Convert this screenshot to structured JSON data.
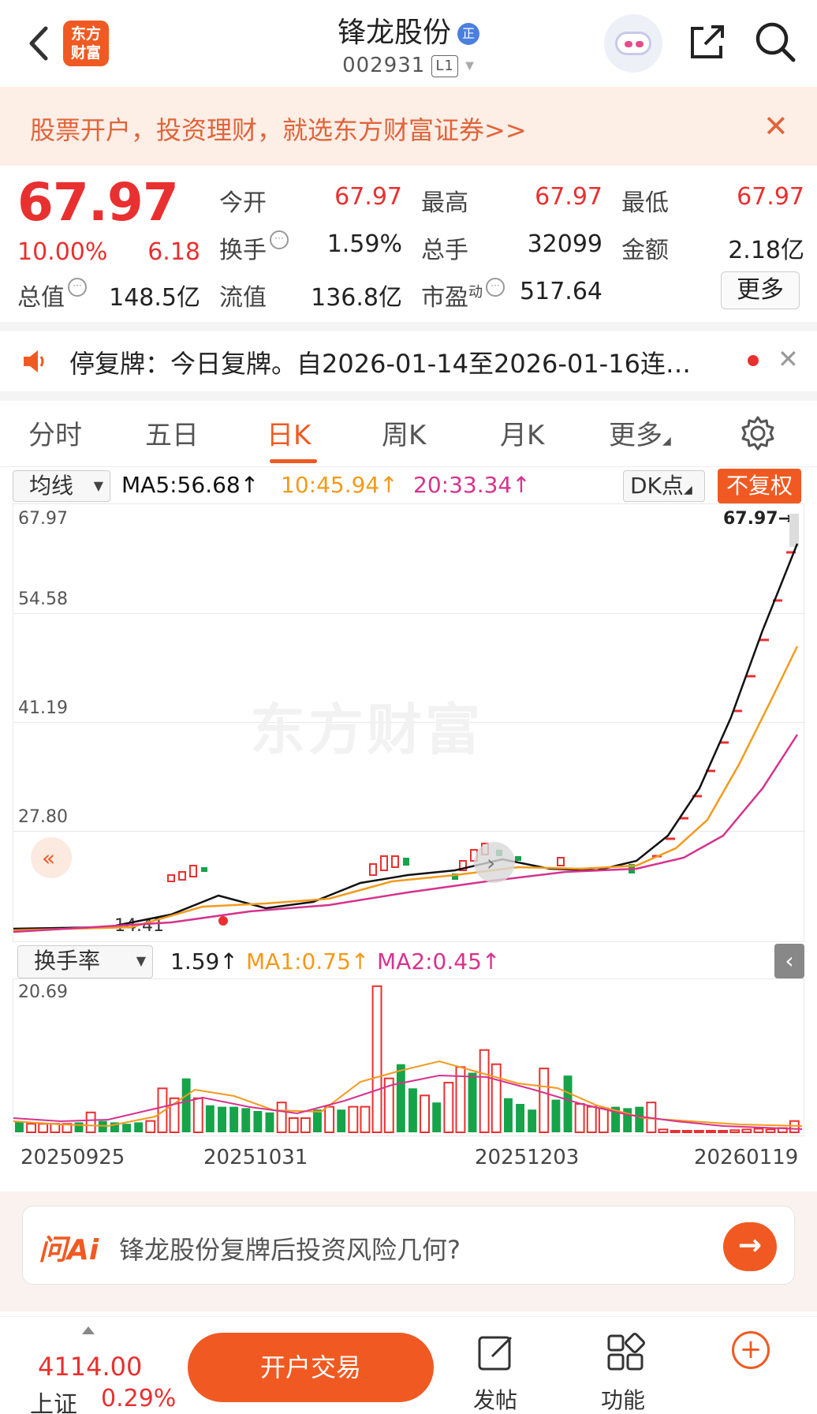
{
  "nav": {
    "logo_line1": "东方",
    "logo_line2": "财富",
    "stock_name": "锋龙股份",
    "badge": "正",
    "stock_code": "002931",
    "level": "L1"
  },
  "banner": {
    "text": "股票开户，投资理财，就选东方财富证券>>",
    "close": "✕"
  },
  "quote": {
    "price": "67.97",
    "change_pct": "10.00%",
    "change": "6.18",
    "open_label": "今开",
    "open": "67.97",
    "high_label": "最高",
    "high": "67.97",
    "low_label": "最低",
    "low": "67.97",
    "turnover_label": "换手",
    "turnover": "1.59%",
    "volume_label": "总手",
    "volume": "32099",
    "amount_label": "金额",
    "amount": "2.18亿",
    "mktcap_label": "总值",
    "mktcap": "148.5亿",
    "float_label": "流值",
    "float_cap": "136.8亿",
    "pe_label": "市盈",
    "pe_sup": "动",
    "pe": "517.64",
    "more": "更多"
  },
  "notice": {
    "text": "停复牌：今日复牌。自2026-01-14至2026-01-16连…",
    "close": "✕"
  },
  "tabs": [
    "分时",
    "五日",
    "日K",
    "周K",
    "月K",
    "更多",
    "设置"
  ],
  "ma_bar": {
    "selector": "均线",
    "ma5": "MA5:56.68↑",
    "ma10": "10:45.94↑",
    "ma20": "20:33.34↑",
    "dk": "DK点",
    "adjust": "不复权",
    "colors": {
      "ma5": "#111111",
      "ma10": "#f39a1c",
      "ma20": "#d6338c"
    }
  },
  "kline": {
    "y_labels": [
      "67.97",
      "54.58",
      "41.19",
      "27.80"
    ],
    "last_label": "67.97→",
    "low_label": "14.41",
    "watermark": "东方财富"
  },
  "vol_bar": {
    "selector": "换手率",
    "value": "1.59↑",
    "ma1": "MA1:0.75↑",
    "ma2": "MA2:0.45↑",
    "y_top": "20.69",
    "colors": {
      "ma1": "#f39a1c",
      "ma2": "#d6338c"
    }
  },
  "x_labels": [
    "20250925",
    "20251031",
    "20251203",
    "20260119"
  ],
  "chart_data": {
    "type": "bar",
    "title": "",
    "ylabel": "换手率",
    "ylim": [
      0,
      20.69
    ],
    "series": [
      {
        "name": "换手率",
        "values": [
          1.5,
          1.2,
          1.2,
          1.2,
          1.2,
          1.4,
          2.8,
          1.6,
          1.4,
          1.2,
          1.4,
          1.6,
          6.2,
          4.8,
          7.6,
          4.8,
          3.8,
          3.6,
          3.6,
          3.4,
          3.0,
          2.8,
          4.2,
          2.0,
          2.0,
          3.2,
          3.6,
          3.2,
          3.6,
          3.6,
          20.6,
          7.6,
          9.6,
          6.2,
          5.2,
          4.2,
          7.0,
          9.2,
          8.4,
          11.6,
          9.6,
          4.8,
          4.0,
          3.2,
          9.0,
          4.6,
          8.0,
          4.0,
          3.6,
          3.4,
          3.6,
          3.4,
          3.6,
          4.2,
          0.4,
          0.2,
          0.2,
          0.2,
          0.2,
          0.2,
          0.3,
          0.4,
          0.5,
          0.4,
          0.6,
          1.59
        ]
      }
    ]
  },
  "ai": {
    "logo": "问Ai",
    "question": "锋龙股份复牌后投资风险几何?",
    "go": "→"
  },
  "bottom": {
    "index_value": "4114.00",
    "index_name": "上证",
    "index_pct": "0.29%",
    "trade": "开户交易",
    "post": "发帖",
    "func": "功能",
    "plus": "+"
  }
}
